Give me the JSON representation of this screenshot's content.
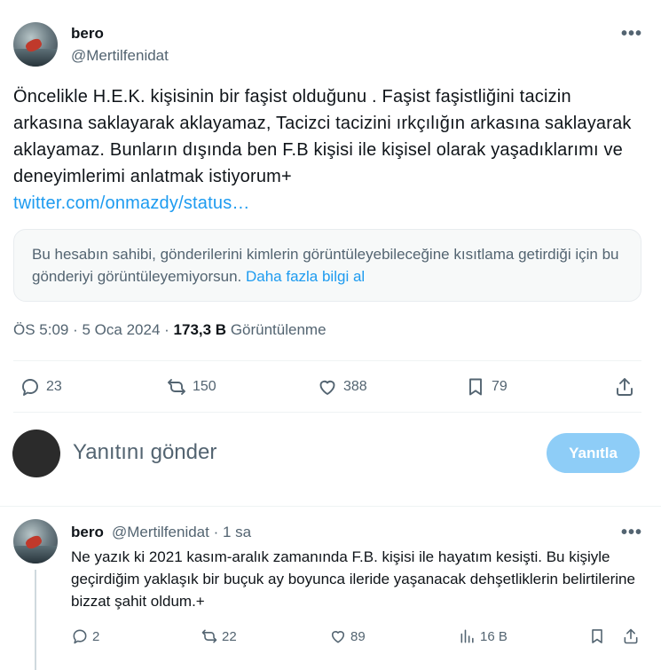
{
  "tweet": {
    "author_name": "bero",
    "author_handle": "@Mertilfenidat",
    "text": "Öncelikle H.E.K. kişisinin bir faşist olduğunu . Faşist faşistliğini tacizin arkasına saklayarak aklayamaz, Tacizci tacizini ırkçılığın arkasına saklayarak aklayamaz. Bunların dışında ben F.B kişisi ile kişisel olarak yaşadıklarımı ve deneyimlerimi anlatmak istiyorum+",
    "link": "twitter.com/onmazdy/status…",
    "notice_text": "Bu hesabın sahibi, gönderilerini kimlerin görüntüleyebileceğine kısıtlama getirdiği için bu gönderiyi görüntüleyemiyorsun.",
    "notice_link": "Daha fazla bilgi al",
    "time": "ÖS 5:09",
    "date": "5 Oca 2024",
    "views_count": "173,3 B",
    "views_label": "Görüntülenme",
    "replies": "23",
    "retweets": "150",
    "likes": "388",
    "bookmarks": "79",
    "more_icon": "more-horizontal-icon"
  },
  "reply_box": {
    "placeholder": "Yanıtını gönder",
    "button_label": "Yanıtla"
  },
  "reply_tweet": {
    "author_name": "bero",
    "author_handle": "@Mertilfenidat",
    "time_ago": "1 sa",
    "text": "Ne yazık ki 2021 kasım-aralık zamanında F.B. kişisi ile hayatım kesişti. Bu kişiyle geçirdiğim yaklaşık bir buçuk ay boyunca ileride yaşanacak dehşetliklerin belirtilerine bizzat şahit oldum.+",
    "replies": "2",
    "retweets": "22",
    "likes": "89",
    "views": "16 B"
  },
  "colors": {
    "accent": "#1d9bf0",
    "reply_button": "#8ecdf7",
    "muted_text": "#536471"
  }
}
